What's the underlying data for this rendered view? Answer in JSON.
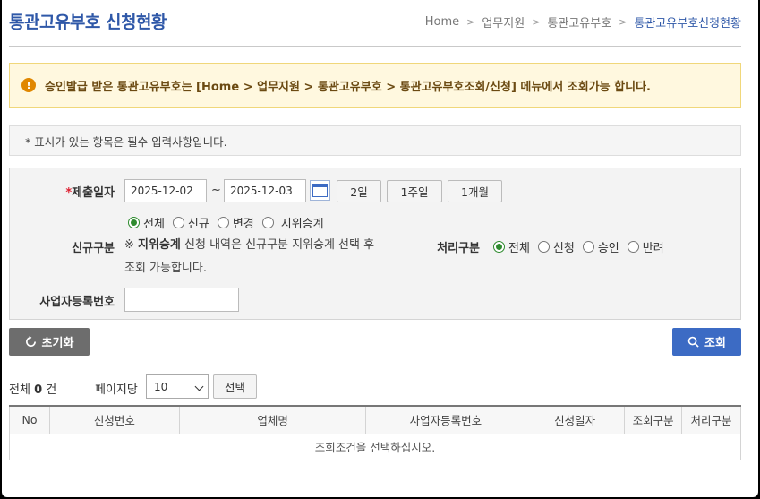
{
  "header": {
    "title": "통관고유부호 신청현황",
    "breadcrumb": [
      "Home",
      "업무지원",
      "통관고유부호",
      "통관고유부호신청현황"
    ]
  },
  "notice": {
    "icon": "exclamation-icon",
    "text": "승인발급 받은 통관고유부호는 [Home > 업무지원 > 통관고유부호 > 통관고유부호조회/신청] 메뉴에서 조회가능 합니다."
  },
  "required_note": "* 표시가 있는 항목은 필수 입력사항입니다.",
  "form": {
    "submit_date": {
      "required_mark": "*",
      "label": "제출일자",
      "from": "2025-12-02",
      "to": "2025-12-03",
      "separator": "~",
      "quick_buttons": [
        "2일",
        "1주일",
        "1개월"
      ]
    },
    "new_type": {
      "label": "신규구분",
      "options": [
        "전체",
        "신규",
        "변경",
        "지위승계"
      ],
      "selected": "전체",
      "hint_mark": "※",
      "hint_bold": "지위승계",
      "hint_rest": "신청 내역은 신규구분 지위승계 선택 후 조회 가능합니다."
    },
    "process_type": {
      "label": "처리구분",
      "options": [
        "전체",
        "신청",
        "승인",
        "반려"
      ],
      "selected": "전체"
    },
    "biz_number": {
      "label": "사업자등록번호",
      "value": ""
    }
  },
  "actions": {
    "reset_label": "초기화",
    "search_label": "조회"
  },
  "list": {
    "total_label": "전체",
    "total_count": "0",
    "total_unit": "건",
    "per_page_label": "페이지당",
    "per_page_value": "10",
    "select_label": "선택",
    "columns": [
      "No",
      "신청번호",
      "업체명",
      "사업자등록번호",
      "신청일자",
      "조회구분",
      "처리구분"
    ],
    "empty_message": "조회조건을 선택하십시오."
  }
}
